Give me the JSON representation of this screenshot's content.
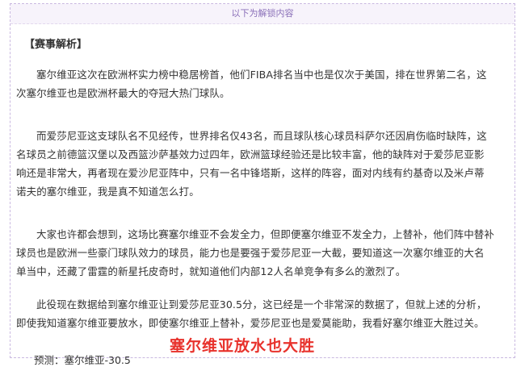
{
  "unlock_header": "以下为解锁内容",
  "section_title": "【赛事解析】",
  "paragraphs": [
    "塞尔维亚这次在欧洲杯实力榜中稳居榜首，他们FIBA排名当中也是仅次于美国，排在世界第二名，这次塞尔维亚也是欧洲杯最大的夺冠大热门球队。",
    "而爱莎尼亚这支球队名不见经传，世界排名仅43名，而且球队核心球员科萨尔还因肩伤临时缺阵，这名球员之前德篮汉堡以及西篮沙萨基效力过四年，欧洲篮球经验还是比较丰富，他的缺阵对于爱莎尼亚影响还是非常大，再者现在爱沙尼亚阵中，只有一名中锋塔斯，这样的阵容，面对内线有约基奇以及米卢蒂诺夫的塞尔维亚，我是真不知道怎么打。",
    "大家也许都会想到，这场比赛塞尔维亚不会发全力，但即便塞尔维亚不发全力，上替补，他们阵中替补球员也是欧洲一些豪门球队效力的球员，能力也是要强于爱莎尼亚一大截，要知道这一次塞尔维亚的大名单当中，还藏了雷霆的新星托皮奇时，就知道他们内部12人名单竞争有多么的激烈了。",
    "此役现在数据给到塞尔维亚让到爱莎尼亚30.5分，这已经是一个非常深的数据了，但就上述的分析，即使我知道塞尔维亚要放水，即使塞尔维亚上替补，爱莎尼亚也是爱莫能助，我看好塞尔维亚大胜过关。"
  ],
  "prediction": "预测：塞尔维亚-30.5",
  "highlight": "塞尔维亚放水也大胜",
  "colors": {
    "highlight": "#e8322c",
    "header_text": "#8a6fb8",
    "border": "#c9b8e0"
  }
}
